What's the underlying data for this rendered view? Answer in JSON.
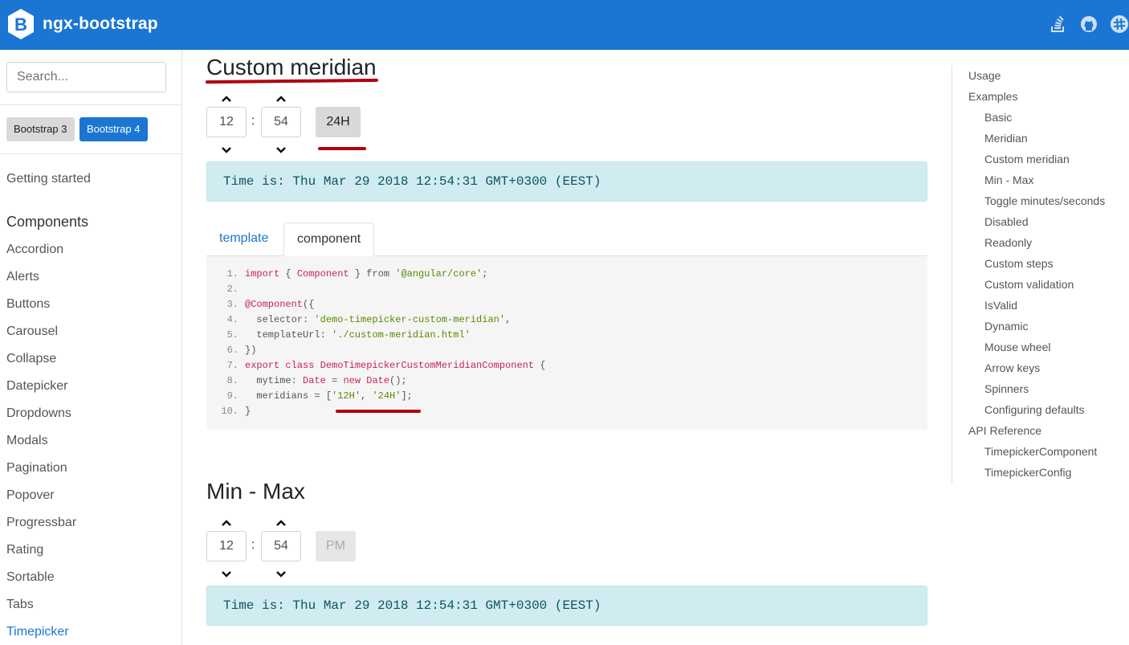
{
  "header": {
    "brand": "ngx-bootstrap",
    "icons": [
      "stackoverflow-icon",
      "github-icon",
      "slack-icon"
    ],
    "color": "#1a76d2"
  },
  "sidebar": {
    "search_placeholder": "Search...",
    "bs3_label": "Bootstrap 3",
    "bs4_label": "Bootstrap 4",
    "getting_started": "Getting started",
    "components_heading": "Components",
    "items": [
      "Accordion",
      "Alerts",
      "Buttons",
      "Carousel",
      "Collapse",
      "Datepicker",
      "Dropdowns",
      "Modals",
      "Pagination",
      "Popover",
      "Progressbar",
      "Rating",
      "Sortable",
      "Tabs",
      "Timepicker"
    ],
    "active": "Timepicker"
  },
  "section1": {
    "title": "Custom meridian",
    "hours": "12",
    "minutes": "54",
    "separator": ":",
    "meridian": "24H",
    "time_text": "Time is: Thu Mar 29 2018 12:54:31 GMT+0300 (EEST)",
    "tabs": [
      "template",
      "component"
    ],
    "active_tab": "component",
    "code_lines": [
      {
        "n": "1.",
        "parts": [
          [
            "kw",
            "import"
          ],
          [
            "plain",
            " { "
          ],
          [
            "kw",
            "Component"
          ],
          [
            "plain",
            " } from "
          ],
          [
            "str",
            "'@angular/core'"
          ],
          [
            "plain",
            ";"
          ]
        ]
      },
      {
        "n": "2.",
        "parts": []
      },
      {
        "n": "3.",
        "parts": [
          [
            "kw",
            "@Component"
          ],
          [
            "plain",
            "({"
          ]
        ]
      },
      {
        "n": "4.",
        "parts": [
          [
            "plain",
            "  selector: "
          ],
          [
            "str",
            "'demo-timepicker-custom-meridian'"
          ],
          [
            "plain",
            ","
          ]
        ]
      },
      {
        "n": "5.",
        "parts": [
          [
            "plain",
            "  templateUrl: "
          ],
          [
            "str",
            "'./custom-meridian.html'"
          ]
        ]
      },
      {
        "n": "6.",
        "parts": [
          [
            "plain",
            "})"
          ]
        ]
      },
      {
        "n": "7.",
        "parts": [
          [
            "kw",
            "export class "
          ],
          [
            "kw",
            "DemoTimepickerCustomMeridianComponent"
          ],
          [
            "plain",
            " {"
          ]
        ]
      },
      {
        "n": "8.",
        "parts": [
          [
            "plain",
            "  mytime: "
          ],
          [
            "kw",
            "Date"
          ],
          [
            "plain",
            " = "
          ],
          [
            "kw",
            "new Date"
          ],
          [
            "plain",
            "();"
          ]
        ]
      },
      {
        "n": "9.",
        "parts": [
          [
            "plain",
            "  meridians = ["
          ],
          [
            "str",
            "'12H'"
          ],
          [
            "plain",
            ", "
          ],
          [
            "str",
            "'24H'"
          ],
          [
            "plain",
            "];"
          ]
        ]
      },
      {
        "n": "10.",
        "parts": [
          [
            "plain",
            "}"
          ]
        ]
      }
    ]
  },
  "section2": {
    "title": "Min - Max",
    "hours": "12",
    "minutes": "54",
    "separator": ":",
    "meridian": "PM",
    "time_text": "Time is: Thu Mar 29 2018 12:54:31 GMT+0300 (EEST)"
  },
  "toc": {
    "items": [
      {
        "label": "Usage",
        "level": 0
      },
      {
        "label": "Examples",
        "level": 0
      },
      {
        "label": "Basic",
        "level": 1
      },
      {
        "label": "Meridian",
        "level": 1
      },
      {
        "label": "Custom meridian",
        "level": 1
      },
      {
        "label": "Min - Max",
        "level": 1
      },
      {
        "label": "Toggle minutes/seconds",
        "level": 1
      },
      {
        "label": "Disabled",
        "level": 1
      },
      {
        "label": "Readonly",
        "level": 1
      },
      {
        "label": "Custom steps",
        "level": 1
      },
      {
        "label": "Custom validation",
        "level": 1
      },
      {
        "label": "IsValid",
        "level": 1
      },
      {
        "label": "Dynamic",
        "level": 1
      },
      {
        "label": "Mouse wheel",
        "level": 1
      },
      {
        "label": "Arrow keys",
        "level": 1
      },
      {
        "label": "Spinners",
        "level": 1
      },
      {
        "label": "Configuring defaults",
        "level": 1
      },
      {
        "label": "API Reference",
        "level": 0
      },
      {
        "label": "TimepickerComponent",
        "level": 1
      },
      {
        "label": "TimepickerConfig",
        "level": 1
      }
    ]
  },
  "annotation_color": "#b00010"
}
